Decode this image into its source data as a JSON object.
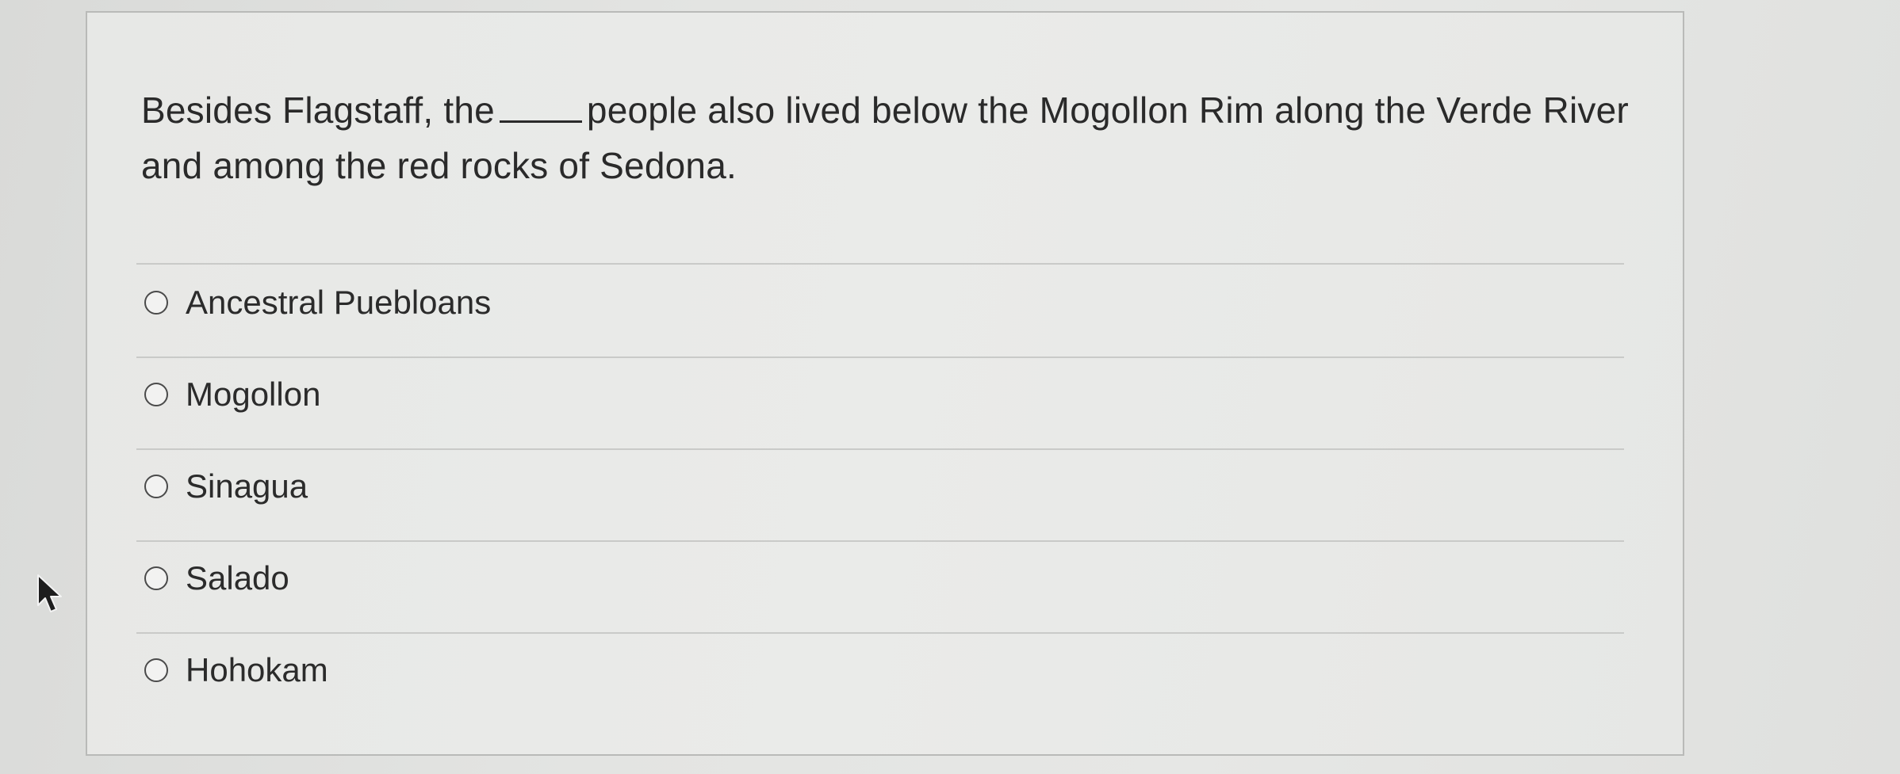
{
  "question": {
    "text_before_blank": "Besides Flagstaff, the",
    "text_after_blank": "people also lived below the Mogollon Rim along the Verde River and among the red rocks of Sedona."
  },
  "options": [
    {
      "label": "Ancestral Puebloans",
      "selected": false
    },
    {
      "label": "Mogollon",
      "selected": false
    },
    {
      "label": "Sinagua",
      "selected": false
    },
    {
      "label": "Salado",
      "selected": false
    },
    {
      "label": "Hohokam",
      "selected": false
    }
  ],
  "colors": {
    "background": "#e3e4e2",
    "card_border": "#b9bab8",
    "text": "#2a2a2a",
    "separator": "#c9cac8"
  },
  "icons": {
    "cursor": "mouse-pointer-icon",
    "radio": "radio-circle-icon"
  }
}
